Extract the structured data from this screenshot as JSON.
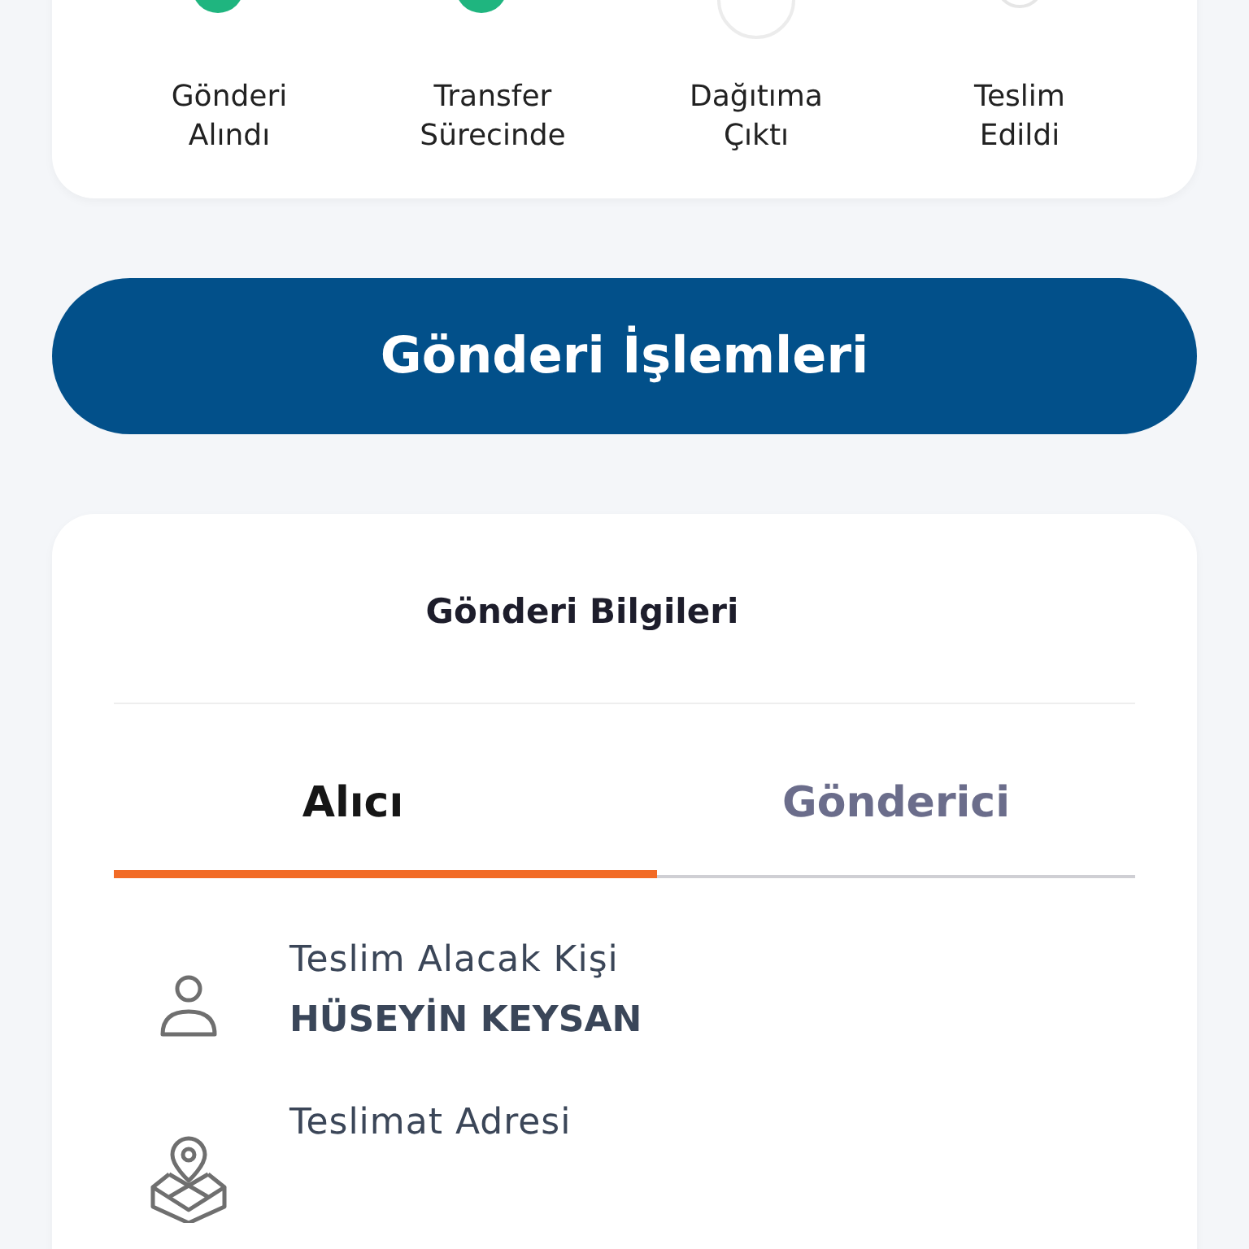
{
  "steps": [
    {
      "label": "Gönderi\nAlındı",
      "kind": "done"
    },
    {
      "label": "Transfer\nSürecinde",
      "kind": "done"
    },
    {
      "label": "Dağıtıma\nÇıktı",
      "kind": "current"
    },
    {
      "label": "Teslim\nEdildi",
      "kind": "pending"
    }
  ],
  "action_button": "Gönderi İşlemleri",
  "info_card": {
    "title": "Gönderi Bilgileri",
    "tabs": [
      {
        "label": "Alıcı",
        "selected": true
      },
      {
        "label": "Gönderici",
        "selected": false
      }
    ],
    "fields": [
      {
        "kind": "person",
        "label": "Teslim Alacak Kişi",
        "value": "HÜSEYİN KEYSAN"
      },
      {
        "kind": "address",
        "label": "Teslimat Adresi"
      }
    ]
  }
}
